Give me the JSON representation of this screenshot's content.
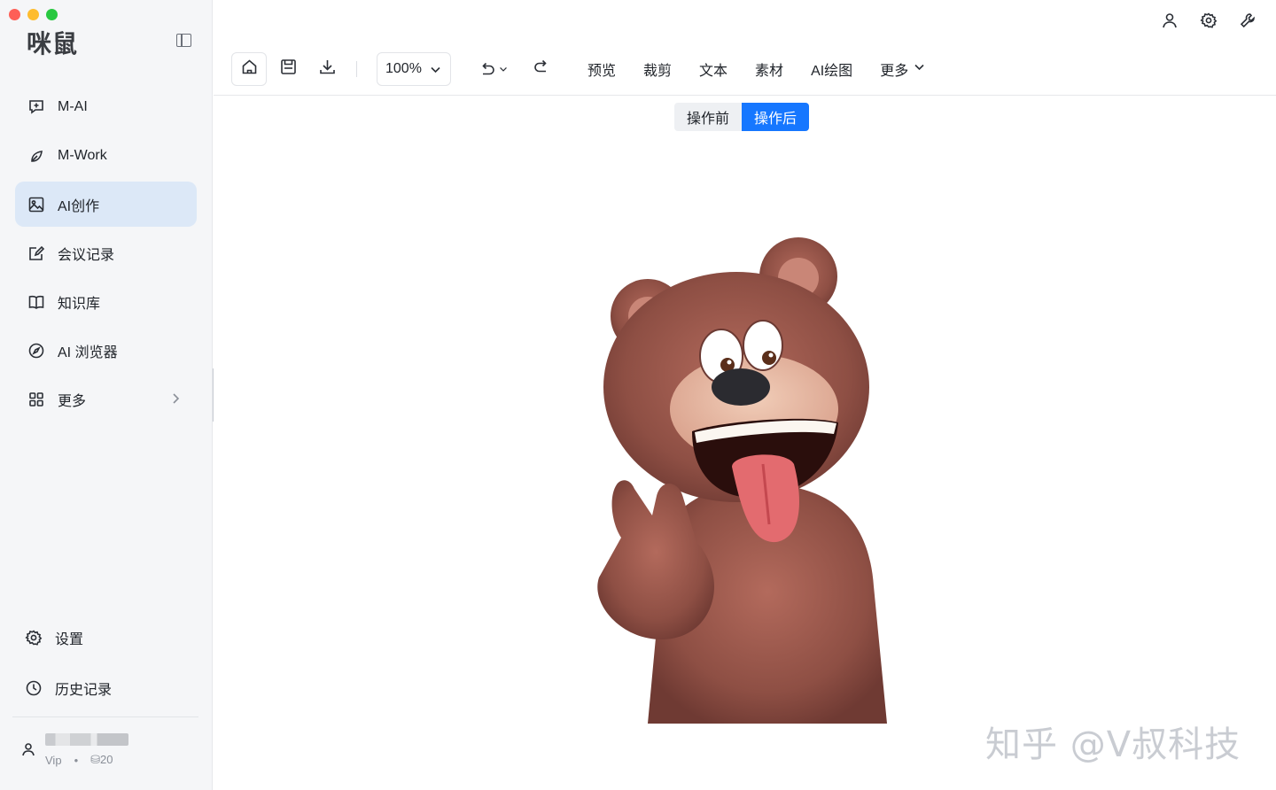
{
  "app": {
    "logo": "咪鼠"
  },
  "sidebar": {
    "items": [
      {
        "label": "M-AI",
        "icon": "chat-plus-icon"
      },
      {
        "label": "M-Work",
        "icon": "leaf-icon"
      },
      {
        "label": "AI创作",
        "icon": "image-icon",
        "active": true
      },
      {
        "label": "会议记录",
        "icon": "edit-note-icon"
      },
      {
        "label": "知识库",
        "icon": "book-icon"
      },
      {
        "label": "AI 浏览器",
        "icon": "compass-icon"
      },
      {
        "label": "更多",
        "icon": "grid-icon"
      }
    ],
    "bottom": [
      {
        "label": "设置",
        "icon": "gear-icon"
      },
      {
        "label": "历史记录",
        "icon": "clock-icon"
      }
    ],
    "user": {
      "tier": "Vip",
      "dot": "•",
      "credits": "⛁20"
    }
  },
  "toolbar": {
    "zoom": "100%",
    "menu": [
      "预览",
      "裁剪",
      "文本",
      "素材",
      "AI绘图"
    ],
    "more": "更多"
  },
  "compare": {
    "before": "操作前",
    "after": "操作后",
    "selected": "after"
  },
  "watermark": "知乎 @V叔科技",
  "colors": {
    "accent": "#1677ff",
    "active_nav_bg": "#dce8f7",
    "sidebar_bg": "#f5f6f8"
  }
}
